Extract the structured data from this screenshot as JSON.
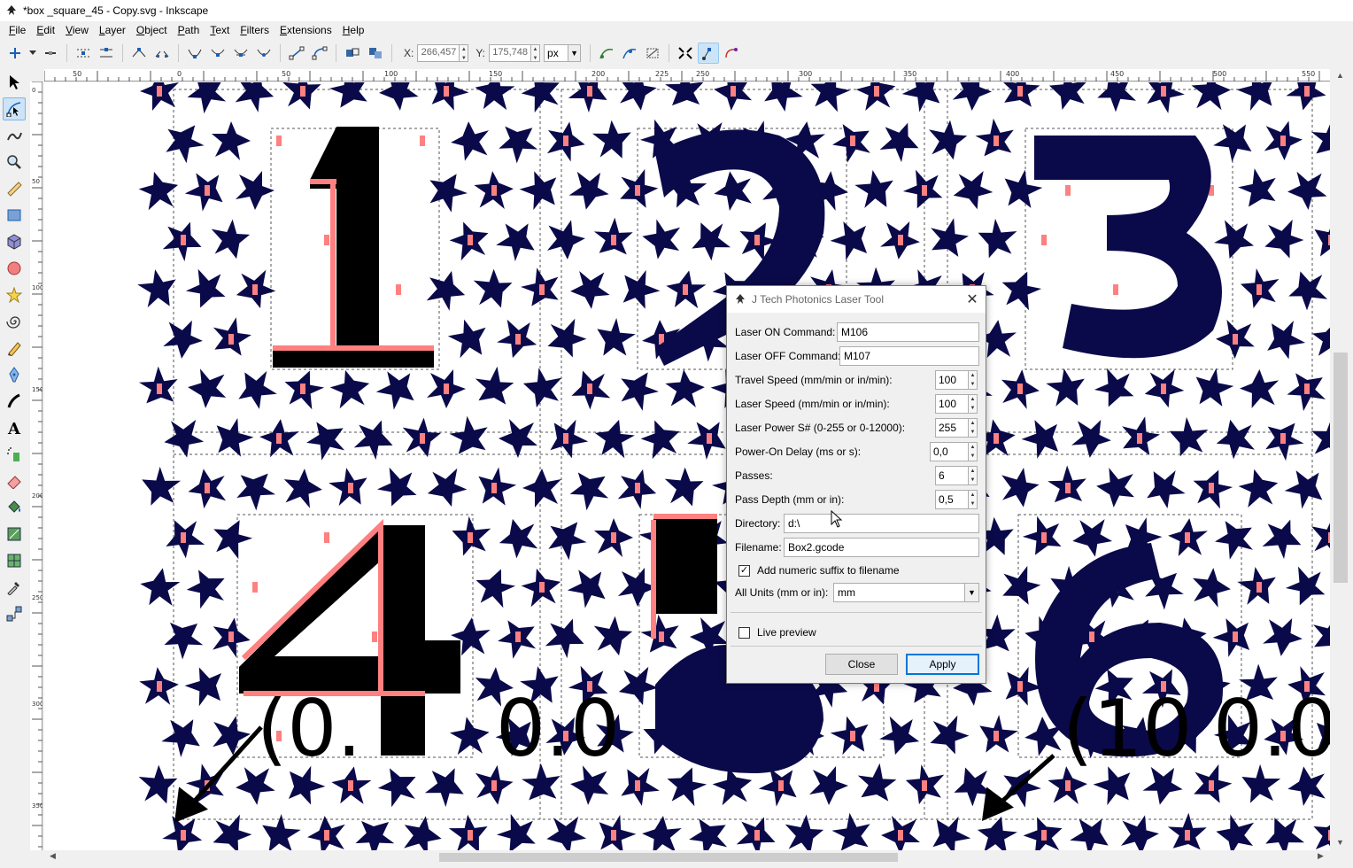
{
  "window": {
    "title": "*box _square_45 - Copy.svg - Inkscape"
  },
  "menu": [
    {
      "label": "File",
      "key": "F",
      "rest": "ile"
    },
    {
      "label": "Edit",
      "key": "E",
      "rest": "dit"
    },
    {
      "label": "View",
      "key": "V",
      "rest": "iew"
    },
    {
      "label": "Layer",
      "key": "L",
      "rest": "ayer"
    },
    {
      "label": "Object",
      "key": "O",
      "rest": "bject"
    },
    {
      "label": "Path",
      "key": "P",
      "rest": "ath"
    },
    {
      "label": "Text",
      "key": "T",
      "rest": "ext"
    },
    {
      "label": "Filters",
      "key": "F",
      "rest": "ilters"
    },
    {
      "label": "Extensions",
      "key": "E",
      "rest": "xtensions"
    },
    {
      "label": "Help",
      "key": "H",
      "rest": "elp"
    }
  ],
  "toolbar": {
    "x_label": "X:",
    "x_value": "266,457",
    "y_label": "Y:",
    "y_value": "175,748",
    "unit": "px"
  },
  "ruler": {
    "top_ticks": [
      "50",
      "0",
      "50",
      "100",
      "150",
      "200",
      "225",
      "250",
      "300",
      "350",
      "400",
      "450",
      "500",
      "550"
    ],
    "left_ticks": [
      "0",
      "50",
      "100",
      "150",
      "200",
      "250",
      "300",
      "350",
      "400",
      "450",
      "500",
      "550"
    ]
  },
  "canvas": {
    "bg_text_left": "(0.",
    "bg_text_mid": "0.0",
    "bg_text_right": "(10",
    "bg_text_far_right": "0.0"
  },
  "dialog": {
    "title": "J Tech Photonics Laser Tool",
    "laser_on": {
      "label": "Laser ON Command:",
      "value": "M106"
    },
    "laser_off": {
      "label": "Laser OFF Command:",
      "value": "M107"
    },
    "travel_speed": {
      "label": "Travel Speed (mm/min or in/min):",
      "value": "100"
    },
    "laser_speed": {
      "label": "Laser Speed (mm/min or in/min):",
      "value": "100"
    },
    "laser_power": {
      "label": "Laser Power S# (0-255 or 0-12000):",
      "value": "255"
    },
    "power_on_delay": {
      "label": "Power-On Delay (ms or s):",
      "value": "0,0"
    },
    "passes": {
      "label": "Passes:",
      "value": "6"
    },
    "pass_depth": {
      "label": "Pass Depth (mm or in):",
      "value": "0,5"
    },
    "directory": {
      "label": "Directory:",
      "value": "d:\\"
    },
    "filename": {
      "label": "Filename:",
      "value": "Box2.gcode"
    },
    "numeric_suffix": {
      "label": "Add numeric suffix to filename",
      "checked": true
    },
    "units": {
      "label": "All Units (mm or in):",
      "value": "mm"
    },
    "live_preview": {
      "label": "Live preview",
      "checked": false
    },
    "close_label": "Close",
    "apply_label": "Apply"
  },
  "colors": {
    "shape_fill": "#0a0a4a",
    "guide_red": "#ff8080",
    "accent": "#0078d7"
  }
}
